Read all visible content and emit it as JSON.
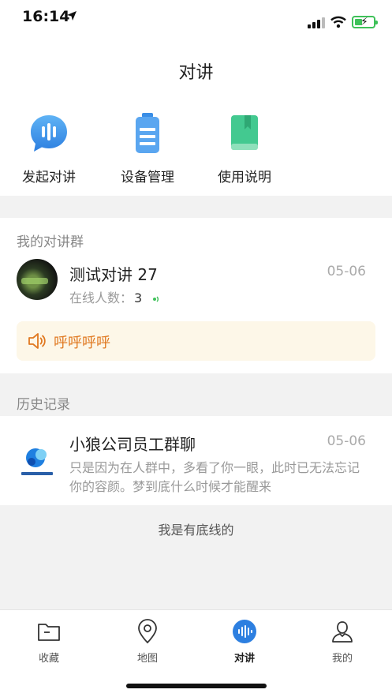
{
  "status": {
    "time": "16:14"
  },
  "header": {
    "title": "对讲"
  },
  "quick_actions": [
    {
      "label": "发起对讲",
      "icon": "voice-bubble-icon"
    },
    {
      "label": "设备管理",
      "icon": "battery-device-icon"
    },
    {
      "label": "使用说明",
      "icon": "book-icon"
    }
  ],
  "groups": {
    "section_title": "我的对讲群",
    "item": {
      "name": "测试对讲 27",
      "date": "05-06",
      "online_label": "在线人数：",
      "online_count": "3"
    },
    "call_banner": {
      "text": "呼呼呼呼"
    }
  },
  "history": {
    "section_title": "历史记录",
    "item": {
      "name": "小狼公司员工群聊",
      "date": "05-06",
      "message": "只是因为在人群中，多看了你一眼，此时已无法忘记你的容颜。梦到底什么时候才能醒来"
    }
  },
  "footer_note": "我是有底线的",
  "tabs": [
    {
      "label": "收藏",
      "icon": "folder-icon"
    },
    {
      "label": "地图",
      "icon": "map-pin-icon"
    },
    {
      "label": "对讲",
      "icon": "intercom-icon",
      "active": true
    },
    {
      "label": "我的",
      "icon": "user-icon"
    }
  ],
  "colors": {
    "accent_blue": "#3a8ee6",
    "accent_green": "#3ec98f",
    "call_orange": "#e07820"
  }
}
